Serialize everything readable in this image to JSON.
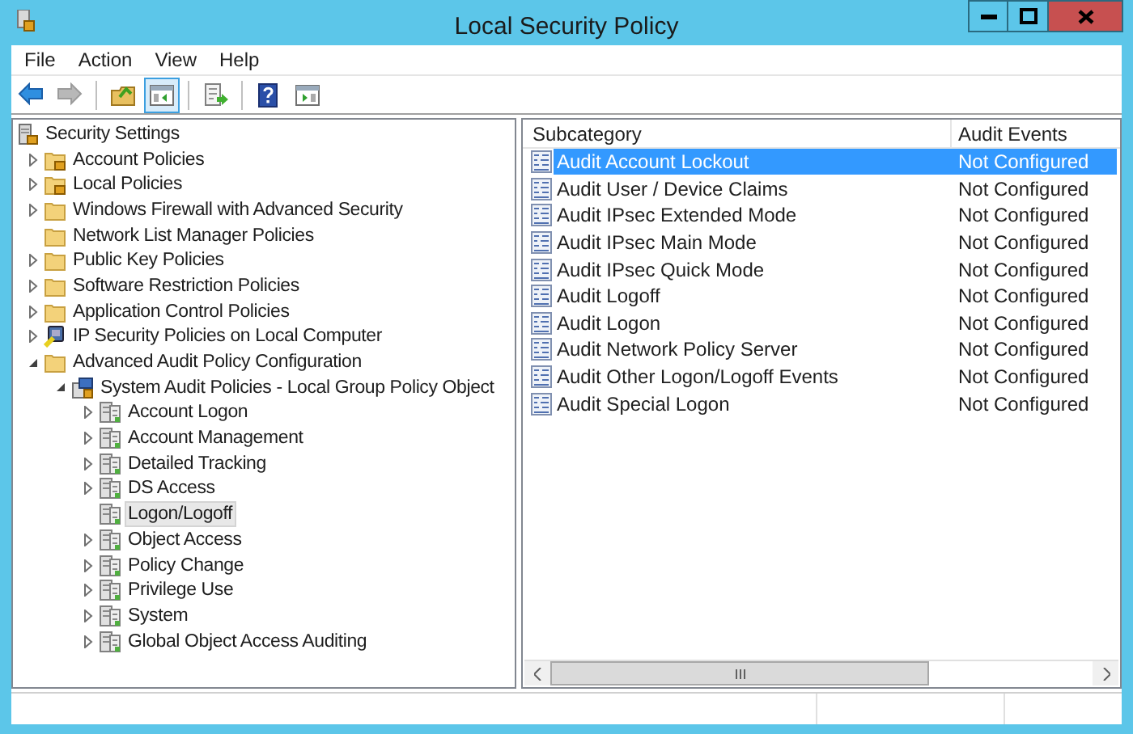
{
  "window": {
    "title": "Local Security Policy"
  },
  "menu": [
    "File",
    "Action",
    "View",
    "Help"
  ],
  "toolbar": [
    {
      "kind": "back",
      "disabled": false,
      "pressed": false
    },
    {
      "kind": "forward",
      "disabled": true,
      "pressed": false
    },
    {
      "kind": "up",
      "disabled": false,
      "pressed": false
    },
    {
      "kind": "console-tree",
      "disabled": false,
      "pressed": true
    },
    {
      "kind": "export",
      "disabled": false,
      "pressed": false
    },
    {
      "kind": "help",
      "disabled": false,
      "pressed": false
    },
    {
      "kind": "action-pane",
      "disabled": false,
      "pressed": false
    }
  ],
  "tree": {
    "label": "Security Settings",
    "kind": "security",
    "selected": false,
    "children": [
      {
        "label": "Account Policies",
        "kind": "locked-folder",
        "selected": false,
        "expanded": false
      },
      {
        "label": "Local Policies",
        "kind": "locked-folder",
        "selected": false,
        "expanded": false
      },
      {
        "label": "Windows Firewall with Advanced Security",
        "kind": "folder",
        "selected": false,
        "expanded": false
      },
      {
        "label": "Network List Manager Policies",
        "kind": "folder",
        "selected": false
      },
      {
        "label": "Public Key Policies",
        "kind": "folder",
        "selected": false,
        "expanded": false
      },
      {
        "label": "Software Restriction Policies",
        "kind": "folder",
        "selected": false,
        "expanded": false
      },
      {
        "label": "Application Control Policies",
        "kind": "folder",
        "selected": false,
        "expanded": false
      },
      {
        "label": "IP Security Policies on Local Computer",
        "kind": "ip-security",
        "selected": false,
        "expanded": false
      },
      {
        "label": "Advanced Audit Policy Configuration",
        "kind": "folder",
        "selected": false,
        "expanded": true,
        "children": [
          {
            "label": "System Audit Policies - Local Group Policy Object",
            "kind": "audit-object",
            "selected": false,
            "expanded": true,
            "children": [
              {
                "label": "Account Logon",
                "kind": "audit-category",
                "selected": false,
                "expanded": false
              },
              {
                "label": "Account Management",
                "kind": "audit-category",
                "selected": false,
                "expanded": false
              },
              {
                "label": "Detailed Tracking",
                "kind": "audit-category",
                "selected": false,
                "expanded": false
              },
              {
                "label": "DS Access",
                "kind": "audit-category",
                "selected": false,
                "expanded": false
              },
              {
                "label": "Logon/Logoff",
                "kind": "audit-category",
                "selected": true
              },
              {
                "label": "Object Access",
                "kind": "audit-category",
                "selected": false,
                "expanded": false
              },
              {
                "label": "Policy Change",
                "kind": "audit-category",
                "selected": false,
                "expanded": false
              },
              {
                "label": "Privilege Use",
                "kind": "audit-category",
                "selected": false,
                "expanded": false
              },
              {
                "label": "System",
                "kind": "audit-category",
                "selected": false,
                "expanded": false
              },
              {
                "label": "Global Object Access Auditing",
                "kind": "audit-category",
                "selected": false,
                "expanded": false
              }
            ]
          }
        ]
      }
    ]
  },
  "table": {
    "columns": [
      "Subcategory",
      "Audit Events"
    ],
    "rows": [
      {
        "cells": [
          "Audit Account Lockout",
          "Not Configured"
        ],
        "selected": true
      },
      {
        "cells": [
          "Audit User / Device Claims",
          "Not Configured"
        ],
        "selected": false
      },
      {
        "cells": [
          "Audit IPsec Extended Mode",
          "Not Configured"
        ],
        "selected": false
      },
      {
        "cells": [
          "Audit IPsec Main Mode",
          "Not Configured"
        ],
        "selected": false
      },
      {
        "cells": [
          "Audit IPsec Quick Mode",
          "Not Configured"
        ],
        "selected": false
      },
      {
        "cells": [
          "Audit Logoff",
          "Not Configured"
        ],
        "selected": false
      },
      {
        "cells": [
          "Audit Logon",
          "Not Configured"
        ],
        "selected": false
      },
      {
        "cells": [
          "Audit Network Policy Server",
          "Not Configured"
        ],
        "selected": false
      },
      {
        "cells": [
          "Audit Other Logon/Logoff Events",
          "Not Configured"
        ],
        "selected": false
      },
      {
        "cells": [
          "Audit Special Logon",
          "Not Configured"
        ],
        "selected": false
      }
    ]
  }
}
